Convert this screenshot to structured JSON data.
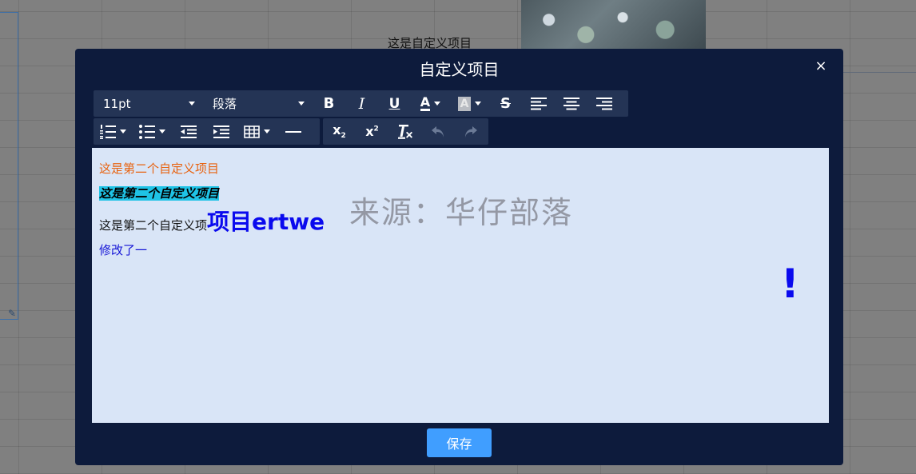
{
  "background": {
    "cell_text": "这是自定义项目"
  },
  "modal": {
    "title": "自定义项目",
    "close_label": "×",
    "save_label": "保存"
  },
  "toolbar": {
    "font_size": "11pt",
    "block_format": "段落",
    "buttons": {
      "bold": "B",
      "italic": "I",
      "underline": "U",
      "text_color": "A",
      "bg_color": "A",
      "strikethrough": "S",
      "subscript": "x",
      "superscript": "x"
    },
    "icons": [
      "bold-icon",
      "italic-icon",
      "underline-icon",
      "text-color-icon",
      "background-color-icon",
      "strikethrough-icon",
      "align-left-icon",
      "align-center-icon",
      "align-right-icon",
      "numbered-list-icon",
      "bullet-list-icon",
      "outdent-icon",
      "indent-icon",
      "table-icon",
      "horizontal-rule-icon",
      "subscript-icon",
      "superscript-icon",
      "clear-format-icon",
      "undo-icon",
      "redo-icon"
    ]
  },
  "editor": {
    "line1": "这是第二个自定义项目",
    "line2": "这是第二个自定义项目",
    "line3_normal": "这是第二个自定义项",
    "line3_big": "项目ertwe",
    "line4": "修改了一",
    "exclaim": "!"
  },
  "watermark": "来源：华仔部落",
  "colors": {
    "modal_bg": "#0d1b3c",
    "toolbar_bg": "#243455",
    "editor_bg": "#d9e5f7",
    "accent": "#409eff",
    "orange_text": "#e8620f",
    "blue_text": "#0a0aee",
    "highlight": "#1fc3e6"
  }
}
